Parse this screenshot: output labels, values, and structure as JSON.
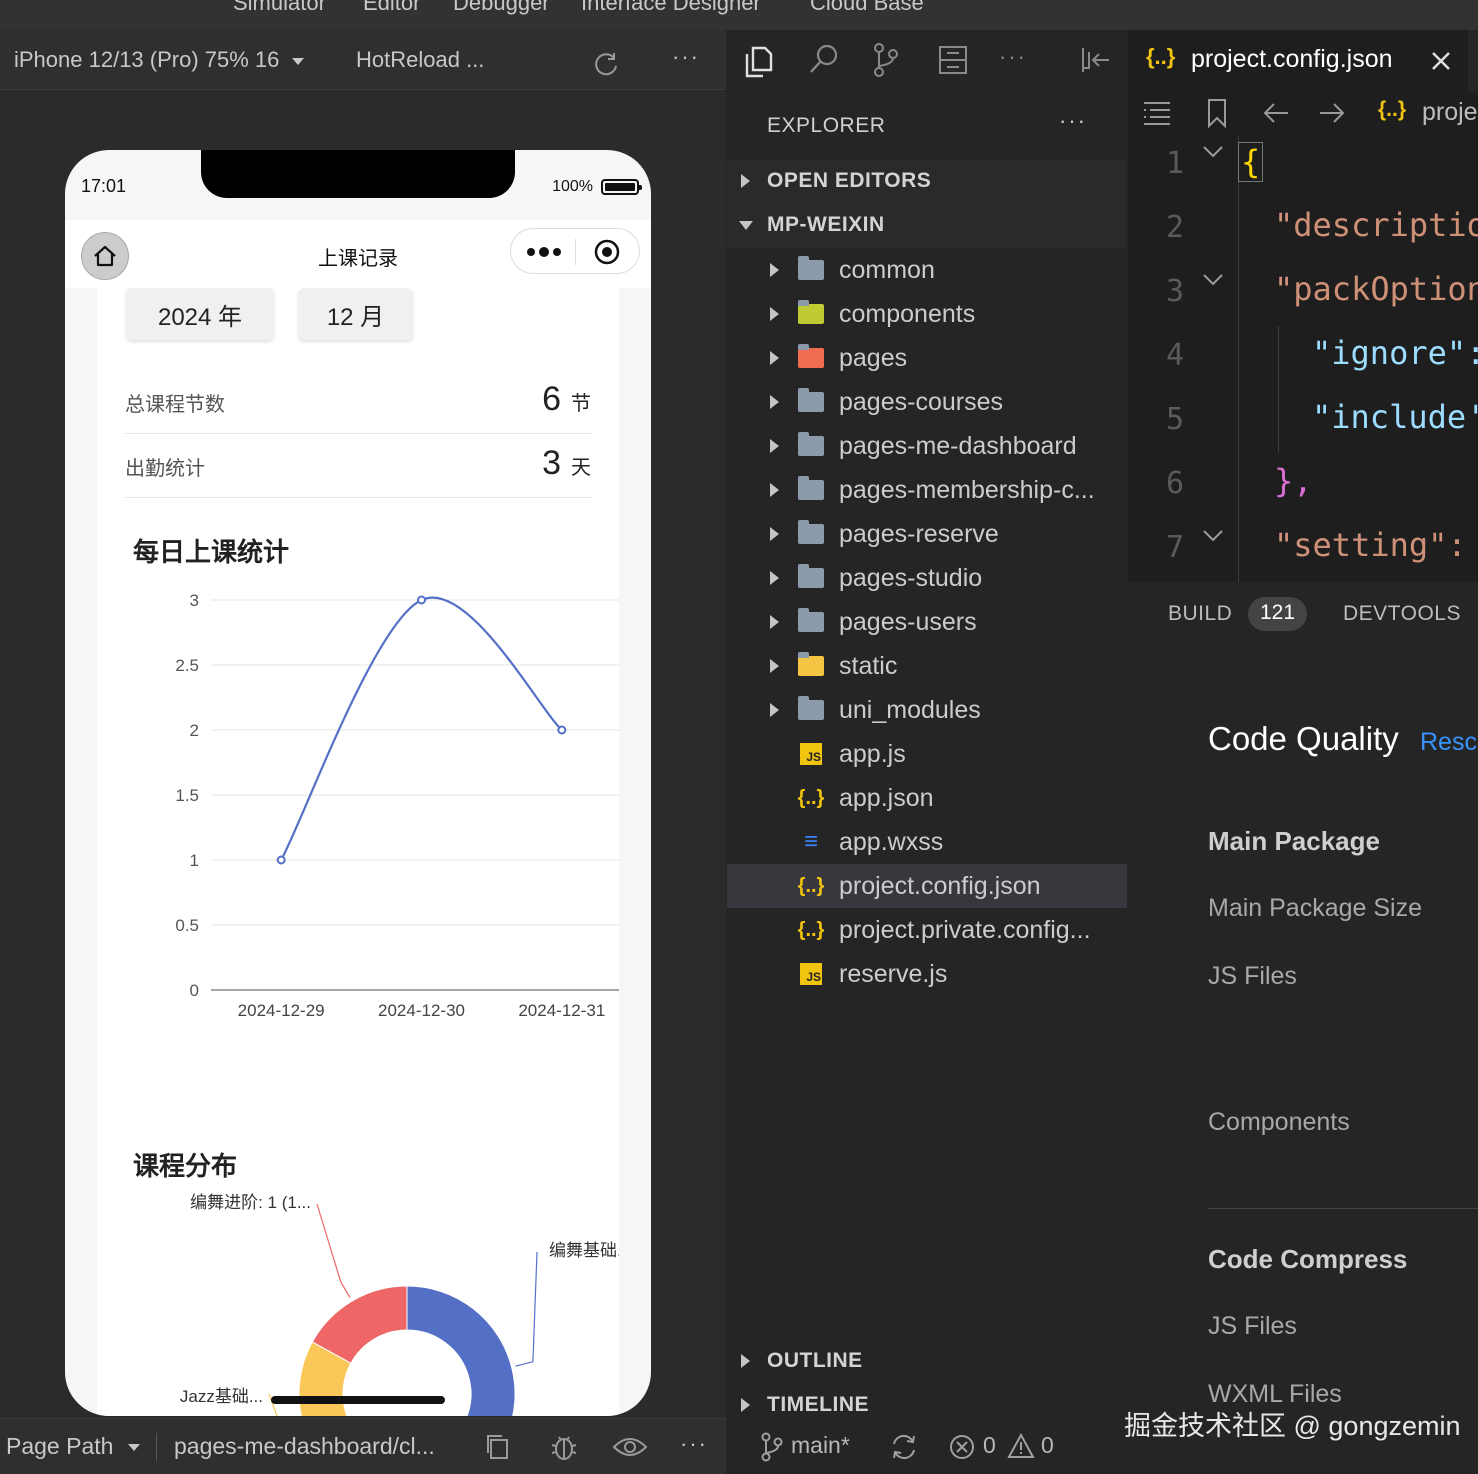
{
  "top_menu": [
    "Simulator",
    "Editor",
    "Debugger",
    "Interface Designer",
    "Cloud Base"
  ],
  "sim_toolbar": {
    "device": "iPhone 12/13 (Pro) 75% 16",
    "hotreload": "HotReload ...",
    "more": "···"
  },
  "phone": {
    "time": "17:01",
    "battery": "100%",
    "nav_title": "上课记录",
    "year_chip": "2024 年",
    "month_chip": "12 月",
    "stats": [
      {
        "label": "总课程节数",
        "value": "6",
        "unit": "节"
      },
      {
        "label": "出勤统计",
        "value": "3",
        "unit": "天"
      }
    ],
    "line_section_title": "每日上课统计",
    "pie_section_title": "课程分布"
  },
  "chart_data": [
    {
      "type": "line",
      "title": "每日上课统计",
      "categories": [
        "2024-12-29",
        "2024-12-30",
        "2024-12-31"
      ],
      "series": [
        {
          "values": [
            1,
            3,
            2
          ],
          "color": "#5470c6"
        }
      ],
      "ylim": [
        0,
        3
      ],
      "yticks": [
        "0",
        "0.5",
        "1",
        "1.5",
        "2",
        "2.5",
        "3"
      ],
      "grid": true
    },
    {
      "type": "pie",
      "title": "课程分布",
      "slices": [
        {
          "label": "编舞基础...",
          "value": 0.42,
          "color": "#5470c6"
        },
        {
          "label": "",
          "value": 0.16,
          "color": "#91cc75"
        },
        {
          "label": "Jazz基础...",
          "value": 0.25,
          "color": "#fac858"
        },
        {
          "label": "编舞进阶: 1 (1...",
          "value": 0.17,
          "color": "#ee6666"
        }
      ]
    }
  ],
  "sim_bottom": {
    "page_path_label": "Page Path",
    "page_path_value": "pages-me-dashboard/cl...",
    "more": "···"
  },
  "explorer": {
    "title": "EXPLORER",
    "more": "···",
    "open_editors": "OPEN EDITORS",
    "project": "MP-WEIXIN",
    "items": [
      {
        "name": "common",
        "kind": "folder",
        "icon": "folder-icon"
      },
      {
        "name": "components",
        "kind": "folder",
        "icon": "folder-components-icon"
      },
      {
        "name": "pages",
        "kind": "folder",
        "icon": "folder-pages-icon"
      },
      {
        "name": "pages-courses",
        "kind": "folder",
        "icon": "folder-icon"
      },
      {
        "name": "pages-me-dashboard",
        "kind": "folder",
        "icon": "folder-icon"
      },
      {
        "name": "pages-membership-c...",
        "kind": "folder",
        "icon": "folder-icon"
      },
      {
        "name": "pages-reserve",
        "kind": "folder",
        "icon": "folder-icon"
      },
      {
        "name": "pages-studio",
        "kind": "folder",
        "icon": "folder-icon"
      },
      {
        "name": "pages-users",
        "kind": "folder",
        "icon": "folder-icon"
      },
      {
        "name": "static",
        "kind": "folder",
        "icon": "folder-static-icon"
      },
      {
        "name": "uni_modules",
        "kind": "folder",
        "icon": "folder-icon"
      },
      {
        "name": "app.js",
        "kind": "file",
        "icon": "js-file-icon"
      },
      {
        "name": "app.json",
        "kind": "file",
        "icon": "json-file-icon"
      },
      {
        "name": "app.wxss",
        "kind": "file",
        "icon": "css-file-icon"
      },
      {
        "name": "project.config.json",
        "kind": "file",
        "icon": "json-file-icon",
        "selected": true
      },
      {
        "name": "project.private.config...",
        "kind": "file",
        "icon": "json-file-icon"
      },
      {
        "name": "reserve.js",
        "kind": "file",
        "icon": "js-file-icon"
      }
    ],
    "outline": "OUTLINE",
    "timeline": "TIMELINE"
  },
  "status_left": {
    "branch": "main*",
    "errors": "0",
    "warnings": "0"
  },
  "editor": {
    "tab_title": "project.config.json",
    "breadcrumb": "proje",
    "lines": [
      {
        "n": "1",
        "text": "{"
      },
      {
        "n": "2",
        "text": "\"descriptio"
      },
      {
        "n": "3",
        "text": "\"packOption"
      },
      {
        "n": "4",
        "text": "\"ignore\":"
      },
      {
        "n": "5",
        "text": "\"include'"
      },
      {
        "n": "6",
        "text": "},"
      },
      {
        "n": "7",
        "text": "\"setting\":"
      }
    ]
  },
  "bottom_panel": {
    "tab_build": "BUILD",
    "build_count": "121",
    "tab_devtools": "DEVTOOLS",
    "title": "Code Quality",
    "rescan": "Resc",
    "main_package": "Main Package",
    "main_package_size": "Main Package Size",
    "js_files": "JS Files",
    "components": "Components",
    "code_compress": "Code Compress",
    "js_files_2": "JS Files",
    "wxml_files": "WXML Files"
  },
  "watermark": "掘金技术社区 @ gongzemin",
  "colors": {
    "accent_blue": "#5470c6",
    "json_yellow": "#f1c40f",
    "link_blue": "#3794ff"
  }
}
